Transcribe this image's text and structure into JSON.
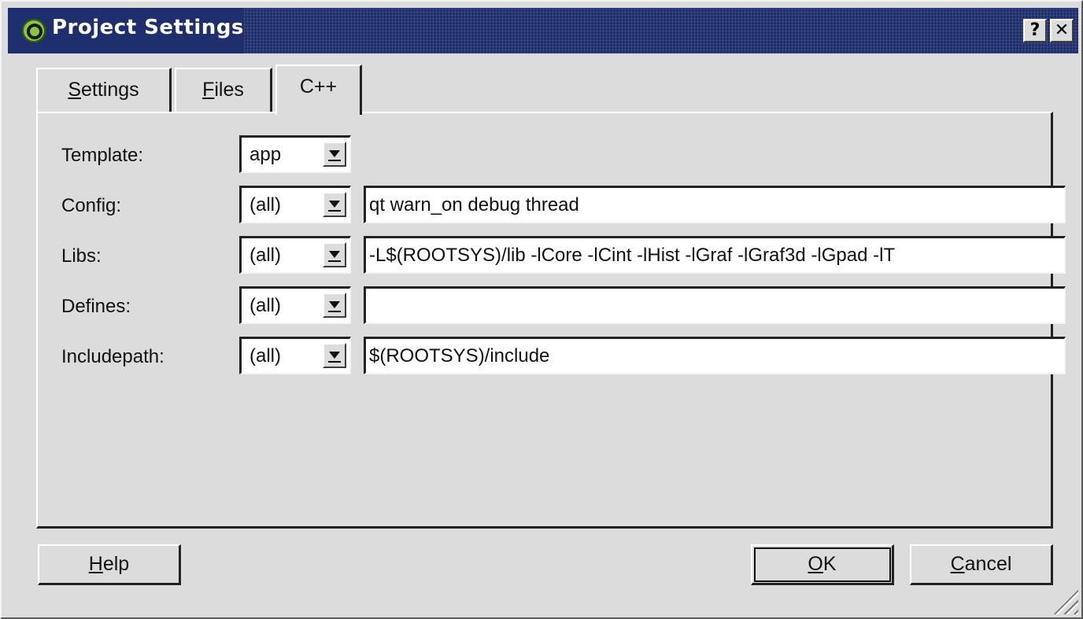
{
  "window": {
    "title": "Project Settings"
  },
  "tabs": [
    {
      "label_ul": "S",
      "label_rest": "ettings"
    },
    {
      "label_ul": "F",
      "label_rest": "iles"
    },
    {
      "label": "C++"
    }
  ],
  "form": {
    "template_label": "Template:",
    "template_value": "app",
    "config_label": "Config:",
    "config_scope": "(all)",
    "config_value": "qt warn_on debug thread",
    "libs_label": "Libs:",
    "libs_scope": "(all)",
    "libs_value": "-L$(ROOTSYS)/lib -lCore -lCint -lHist -lGraf -lGraf3d -lGpad -lT",
    "defines_label": "Defines:",
    "defines_scope": "(all)",
    "defines_value": "",
    "includepath_label": "Includepath:",
    "includepath_scope": "(all)",
    "includepath_value": "$(ROOTSYS)/include"
  },
  "buttons": {
    "help_ul": "H",
    "help_rest": "elp",
    "ok_ul": "O",
    "ok_rest": "K",
    "cancel_ul": "C",
    "cancel_rest": "ancel"
  },
  "titlebar_buttons": {
    "help": "?",
    "close": "✕"
  },
  "colors": {
    "titlebar": "#1f2f6e",
    "face": "#dcdcdc",
    "field": "#ffffff"
  }
}
